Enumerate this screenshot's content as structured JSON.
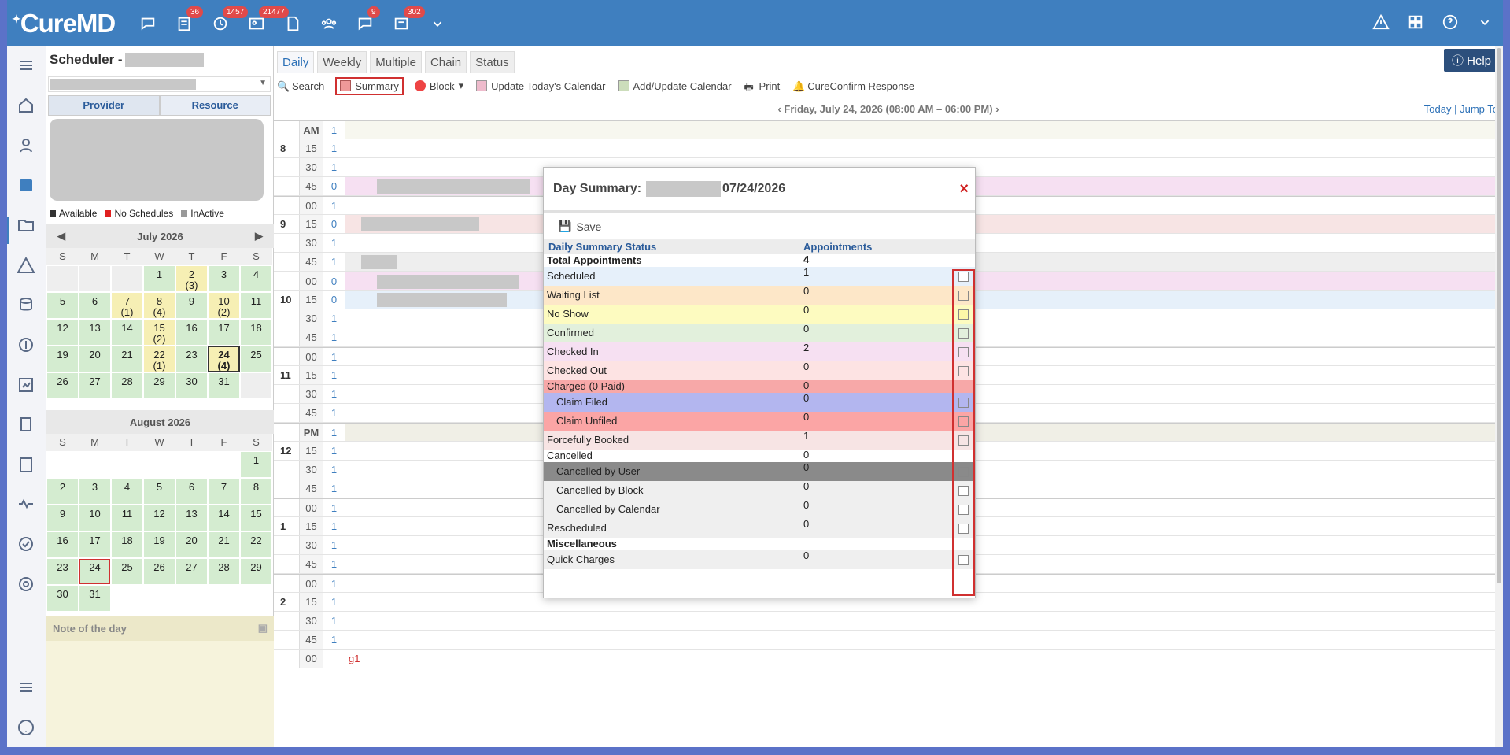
{
  "app": {
    "logo": "CureMD"
  },
  "topbar": {
    "badges": [
      "36",
      "1457",
      "21477",
      "9",
      "302"
    ]
  },
  "side": {
    "title": "Scheduler - ",
    "tab_provider": "Provider",
    "tab_resource": "Resource",
    "legend": [
      "Available",
      "No Schedules",
      "InActive"
    ],
    "july": {
      "title": "July 2026",
      "days": [
        "S",
        "M",
        "T",
        "W",
        "T",
        "F",
        "S"
      ]
    },
    "august": {
      "title": "August 2026",
      "days": [
        "S",
        "M",
        "T",
        "W",
        "T",
        "F",
        "S"
      ]
    },
    "note_title": "Note of the day"
  },
  "main": {
    "tabs": [
      "Daily",
      "Weekly",
      "Multiple",
      "Chain",
      "Status"
    ],
    "help": "Help",
    "toolbar": {
      "search": "Search",
      "summary": "Summary",
      "block": "Block",
      "update": "Update Today's Calendar",
      "add": "Add/Update Calendar",
      "print": "Print",
      "confirm": "CureConfirm Response"
    },
    "date": "Friday, July 24, 2026 (08:00 AM – 06:00 PM)",
    "today": "Today",
    "sep": "|",
    "jump": "Jump To"
  },
  "modal": {
    "title": "Day Summary:",
    "date": "07/24/2026",
    "close": "×",
    "save": "Save",
    "col_status": "Daily Summary Status",
    "col_appts": "Appointments",
    "rows": [
      {
        "label": "Total Appointments",
        "value": "4",
        "bold": true,
        "color": "#ffffff",
        "check": false
      },
      {
        "label": "Scheduled",
        "value": "1",
        "color": "#e6f0fa",
        "check": true,
        "sw": "#fff"
      },
      {
        "label": "Waiting List",
        "value": "0",
        "color": "#fde7c8",
        "check": true,
        "sw": "#fde7c8"
      },
      {
        "label": "No Show",
        "value": "0",
        "color": "#fdfbc0",
        "check": true,
        "sw": "#fdf8a8"
      },
      {
        "label": "Confirmed",
        "value": "0",
        "color": "#e2f0dc",
        "check": true,
        "sw": "#e2f0dc"
      },
      {
        "label": "Checked In",
        "value": "2",
        "color": "#f6e0f2",
        "check": true,
        "sw": "#f6e0f2"
      },
      {
        "label": "Checked Out",
        "value": "0",
        "color": "#fde3e3",
        "check": true,
        "sw": "#fde3e3"
      },
      {
        "label": "Charged (0 Paid)",
        "value": "0",
        "color": "#f7a8a8",
        "check": false
      },
      {
        "label": "Claim Filed",
        "value": "0",
        "color": "#b3b6ef",
        "ind": true,
        "check": true,
        "sw": "#b3b6ef"
      },
      {
        "label": "Claim Unfiled",
        "value": "0",
        "color": "#fba5a5",
        "ind": true,
        "check": true,
        "sw": "#fba5a5"
      },
      {
        "label": "Forcefully Booked",
        "value": "1",
        "color": "#f7e4e4",
        "check": true,
        "sw": "#f7e4e4"
      },
      {
        "label": "Cancelled",
        "value": "0",
        "color": "#ffffff",
        "check": false
      },
      {
        "label": "Cancelled by User",
        "value": "0",
        "color": "#8a8a8a",
        "ind": true,
        "check": true,
        "sw": "#8a8a8a"
      },
      {
        "label": "Cancelled by Block",
        "value": "0",
        "color": "#efefef",
        "ind": true,
        "check": true,
        "sw": "#fff"
      },
      {
        "label": "Cancelled by Calendar",
        "value": "0",
        "color": "#efefef",
        "ind": true,
        "check": true,
        "sw": "#fff"
      },
      {
        "label": "Rescheduled",
        "value": "0",
        "color": "#efefef",
        "check": true,
        "sw": "#fff"
      },
      {
        "label": "Miscellaneous",
        "value": "",
        "bold": true,
        "color": "#ffffff",
        "check": false
      },
      {
        "label": "Quick Charges",
        "value": "0",
        "color": "#efefef",
        "check": true,
        "sw": "#fff"
      }
    ]
  },
  "schedule": {
    "hours": [
      "8",
      "9",
      "10",
      "11",
      "12",
      "1",
      "2"
    ],
    "am": "AM",
    "pm": "PM",
    "last_row": "g1"
  }
}
